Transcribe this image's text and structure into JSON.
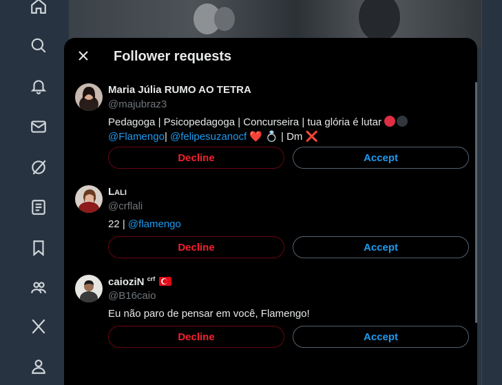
{
  "modal": {
    "title": "Follower requests"
  },
  "requests": [
    {
      "name": "Maria Júlia RUMO AO TETRA",
      "handle": "@majubraz3",
      "bio_text": "Pedagoga | Psicopedagoga | Concurseira | tua glória é lutar",
      "bio_link_1": "@Flamengo",
      "bio_sep": "|",
      "bio_link_2": "@felipesuzanocf",
      "bio_heart": "❤️",
      "bio_ring": "💍",
      "bio_dm": "| Dm",
      "bio_cross": "❌",
      "decline_label": "Decline",
      "accept_label": "Accept"
    },
    {
      "name": "Lalı",
      "handle": "@crflali",
      "bio_text": "22 |",
      "bio_link_1": "@flamengo",
      "decline_label": "Decline",
      "accept_label": "Accept"
    },
    {
      "name": "caioziN",
      "name_sup": "crf",
      "handle": "@B16caio",
      "bio_text": "Eu não paro de pensar em você, Flamengo!",
      "decline_label": "Decline",
      "accept_label": "Accept"
    }
  ],
  "nav": [
    {
      "icon": "home-icon"
    },
    {
      "icon": "search-icon"
    },
    {
      "icon": "notifications-icon"
    },
    {
      "icon": "messages-icon"
    },
    {
      "icon": "grok-icon"
    },
    {
      "icon": "lists-icon"
    },
    {
      "icon": "bookmarks-icon"
    },
    {
      "icon": "communities-icon"
    },
    {
      "icon": "x-premium-icon"
    },
    {
      "icon": "profile-icon"
    }
  ],
  "colors": {
    "accent": "#1d9bf0",
    "decline": "#f4212e",
    "modal_bg": "#000000",
    "backdrop": "#15202b"
  }
}
